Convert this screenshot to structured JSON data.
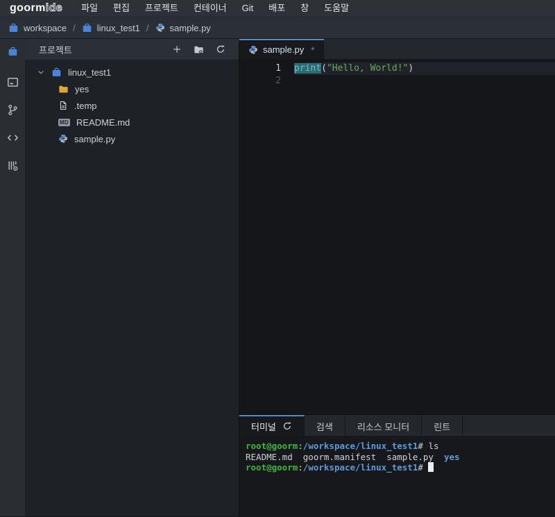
{
  "app": {
    "logo": {
      "bold": "goorm",
      "light": "ide"
    }
  },
  "menu_bar": {
    "items": [
      "파일",
      "편집",
      "프로젝트",
      "컨테이너",
      "Git",
      "배포",
      "창",
      "도움말"
    ]
  },
  "breadcrumb": {
    "separator": "/",
    "items": [
      {
        "icon": "briefcase-icon",
        "label": "workspace"
      },
      {
        "icon": "briefcase-icon",
        "label": "linux_test1"
      },
      {
        "icon": "python-icon",
        "label": "sample.py"
      }
    ]
  },
  "activity_bar": {
    "items": [
      {
        "name": "project",
        "icon": "briefcase-icon",
        "active": true
      },
      {
        "name": "console",
        "icon": "console-icon",
        "active": false
      },
      {
        "name": "git",
        "icon": "git-branch-icon",
        "active": false
      },
      {
        "name": "code",
        "icon": "code-icon",
        "active": false
      },
      {
        "name": "container",
        "icon": "container-icon",
        "active": false
      }
    ]
  },
  "explorer": {
    "title": "프로젝트",
    "actions": [
      {
        "name": "new-file",
        "icon": "plus-icon"
      },
      {
        "name": "new-folder",
        "icon": "new-folder-icon"
      },
      {
        "name": "refresh",
        "icon": "refresh-icon"
      }
    ],
    "tree": [
      {
        "label": "linux_test1",
        "icon": "briefcase-icon",
        "level": 0,
        "expanded": true
      },
      {
        "label": "yes",
        "icon": "folder-icon",
        "level": 1
      },
      {
        "label": ".temp",
        "icon": "file-icon",
        "level": 1
      },
      {
        "label": "README.md",
        "icon": "markdown-icon",
        "level": 1
      },
      {
        "label": "sample.py",
        "icon": "python-icon",
        "level": 1
      }
    ]
  },
  "editor": {
    "tab": {
      "icon": "python-icon",
      "label": "sample.py",
      "modified_indicator": "*"
    },
    "lines": [
      {
        "number": "1",
        "current": true,
        "segments": [
          {
            "text": "print",
            "style": "keyword-highlight"
          },
          {
            "text": "(",
            "style": "plain"
          },
          {
            "text": "\"Hello, World!\"",
            "style": "string"
          },
          {
            "text": ")",
            "style": "plain"
          }
        ]
      },
      {
        "number": "2",
        "current": false,
        "segments": []
      }
    ]
  },
  "bottom_panel": {
    "tabs": [
      {
        "name": "terminal",
        "label": "터미널",
        "icon": "refresh-icon",
        "active": true
      },
      {
        "name": "search",
        "label": "검색",
        "active": false
      },
      {
        "name": "resource-monitor",
        "label": "리소스 모니터",
        "active": false
      },
      {
        "name": "lint",
        "label": "린트",
        "active": false
      }
    ],
    "terminal": {
      "lines": [
        {
          "segments": [
            {
              "text": "root@goorm",
              "style": "user"
            },
            {
              "text": ":",
              "style": "plain"
            },
            {
              "text": "/workspace/linux_test1",
              "style": "path"
            },
            {
              "text": "# ",
              "style": "plain"
            },
            {
              "text": "ls",
              "style": "plain"
            }
          ]
        },
        {
          "segments": [
            {
              "text": "README.md  goorm.manifest  sample.py  ",
              "style": "plain"
            },
            {
              "text": "yes",
              "style": "dir"
            }
          ]
        },
        {
          "segments": [
            {
              "text": "root@goorm",
              "style": "user"
            },
            {
              "text": ":",
              "style": "plain"
            },
            {
              "text": "/workspace/linux_test1",
              "style": "path"
            },
            {
              "text": "# ",
              "style": "plain"
            }
          ],
          "cursor": true
        }
      ]
    }
  },
  "colors": {
    "accent_blue": "#4e8fd0",
    "briefcase_blue": "#4b84d6",
    "folder_yellow": "#dca832",
    "terminal_user_green": "#3fb53f",
    "terminal_path_blue": "#5e9ad8",
    "string_green": "#67ab5a",
    "occurrence_highlight_teal": "#2a6f6f"
  }
}
